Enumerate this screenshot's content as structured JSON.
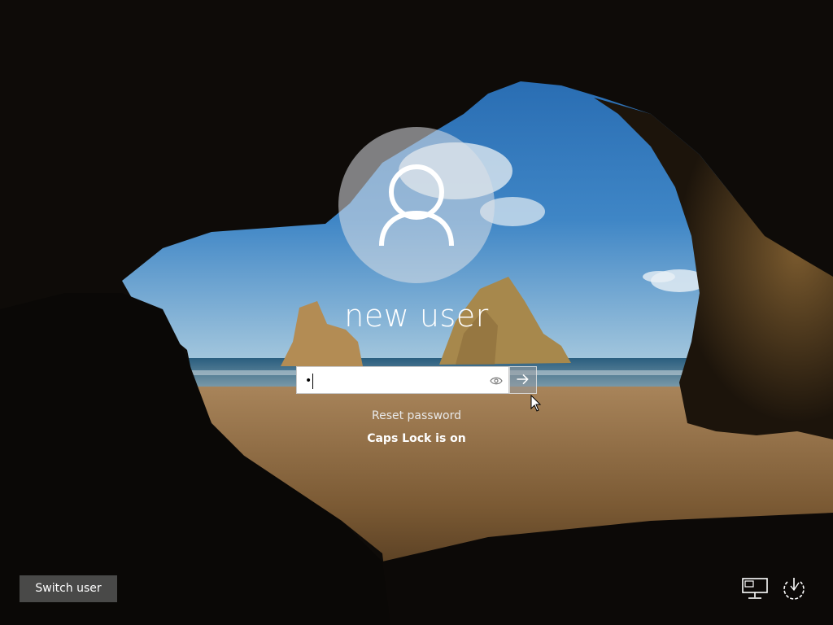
{
  "user": {
    "name": "new user"
  },
  "password": {
    "masked_value": "•",
    "reveal_icon": "eye-icon",
    "submit_icon": "arrow-right-icon"
  },
  "links": {
    "reset_password": "Reset password"
  },
  "status": {
    "caps_lock": "Caps Lock is on"
  },
  "footer": {
    "switch_user_label": "Switch user",
    "network_icon": "network-icon",
    "power_icon": "power-icon"
  },
  "colors": {
    "avatar_bg": "#dce0e6",
    "button_bg": "#555555",
    "text": "#ffffff"
  }
}
